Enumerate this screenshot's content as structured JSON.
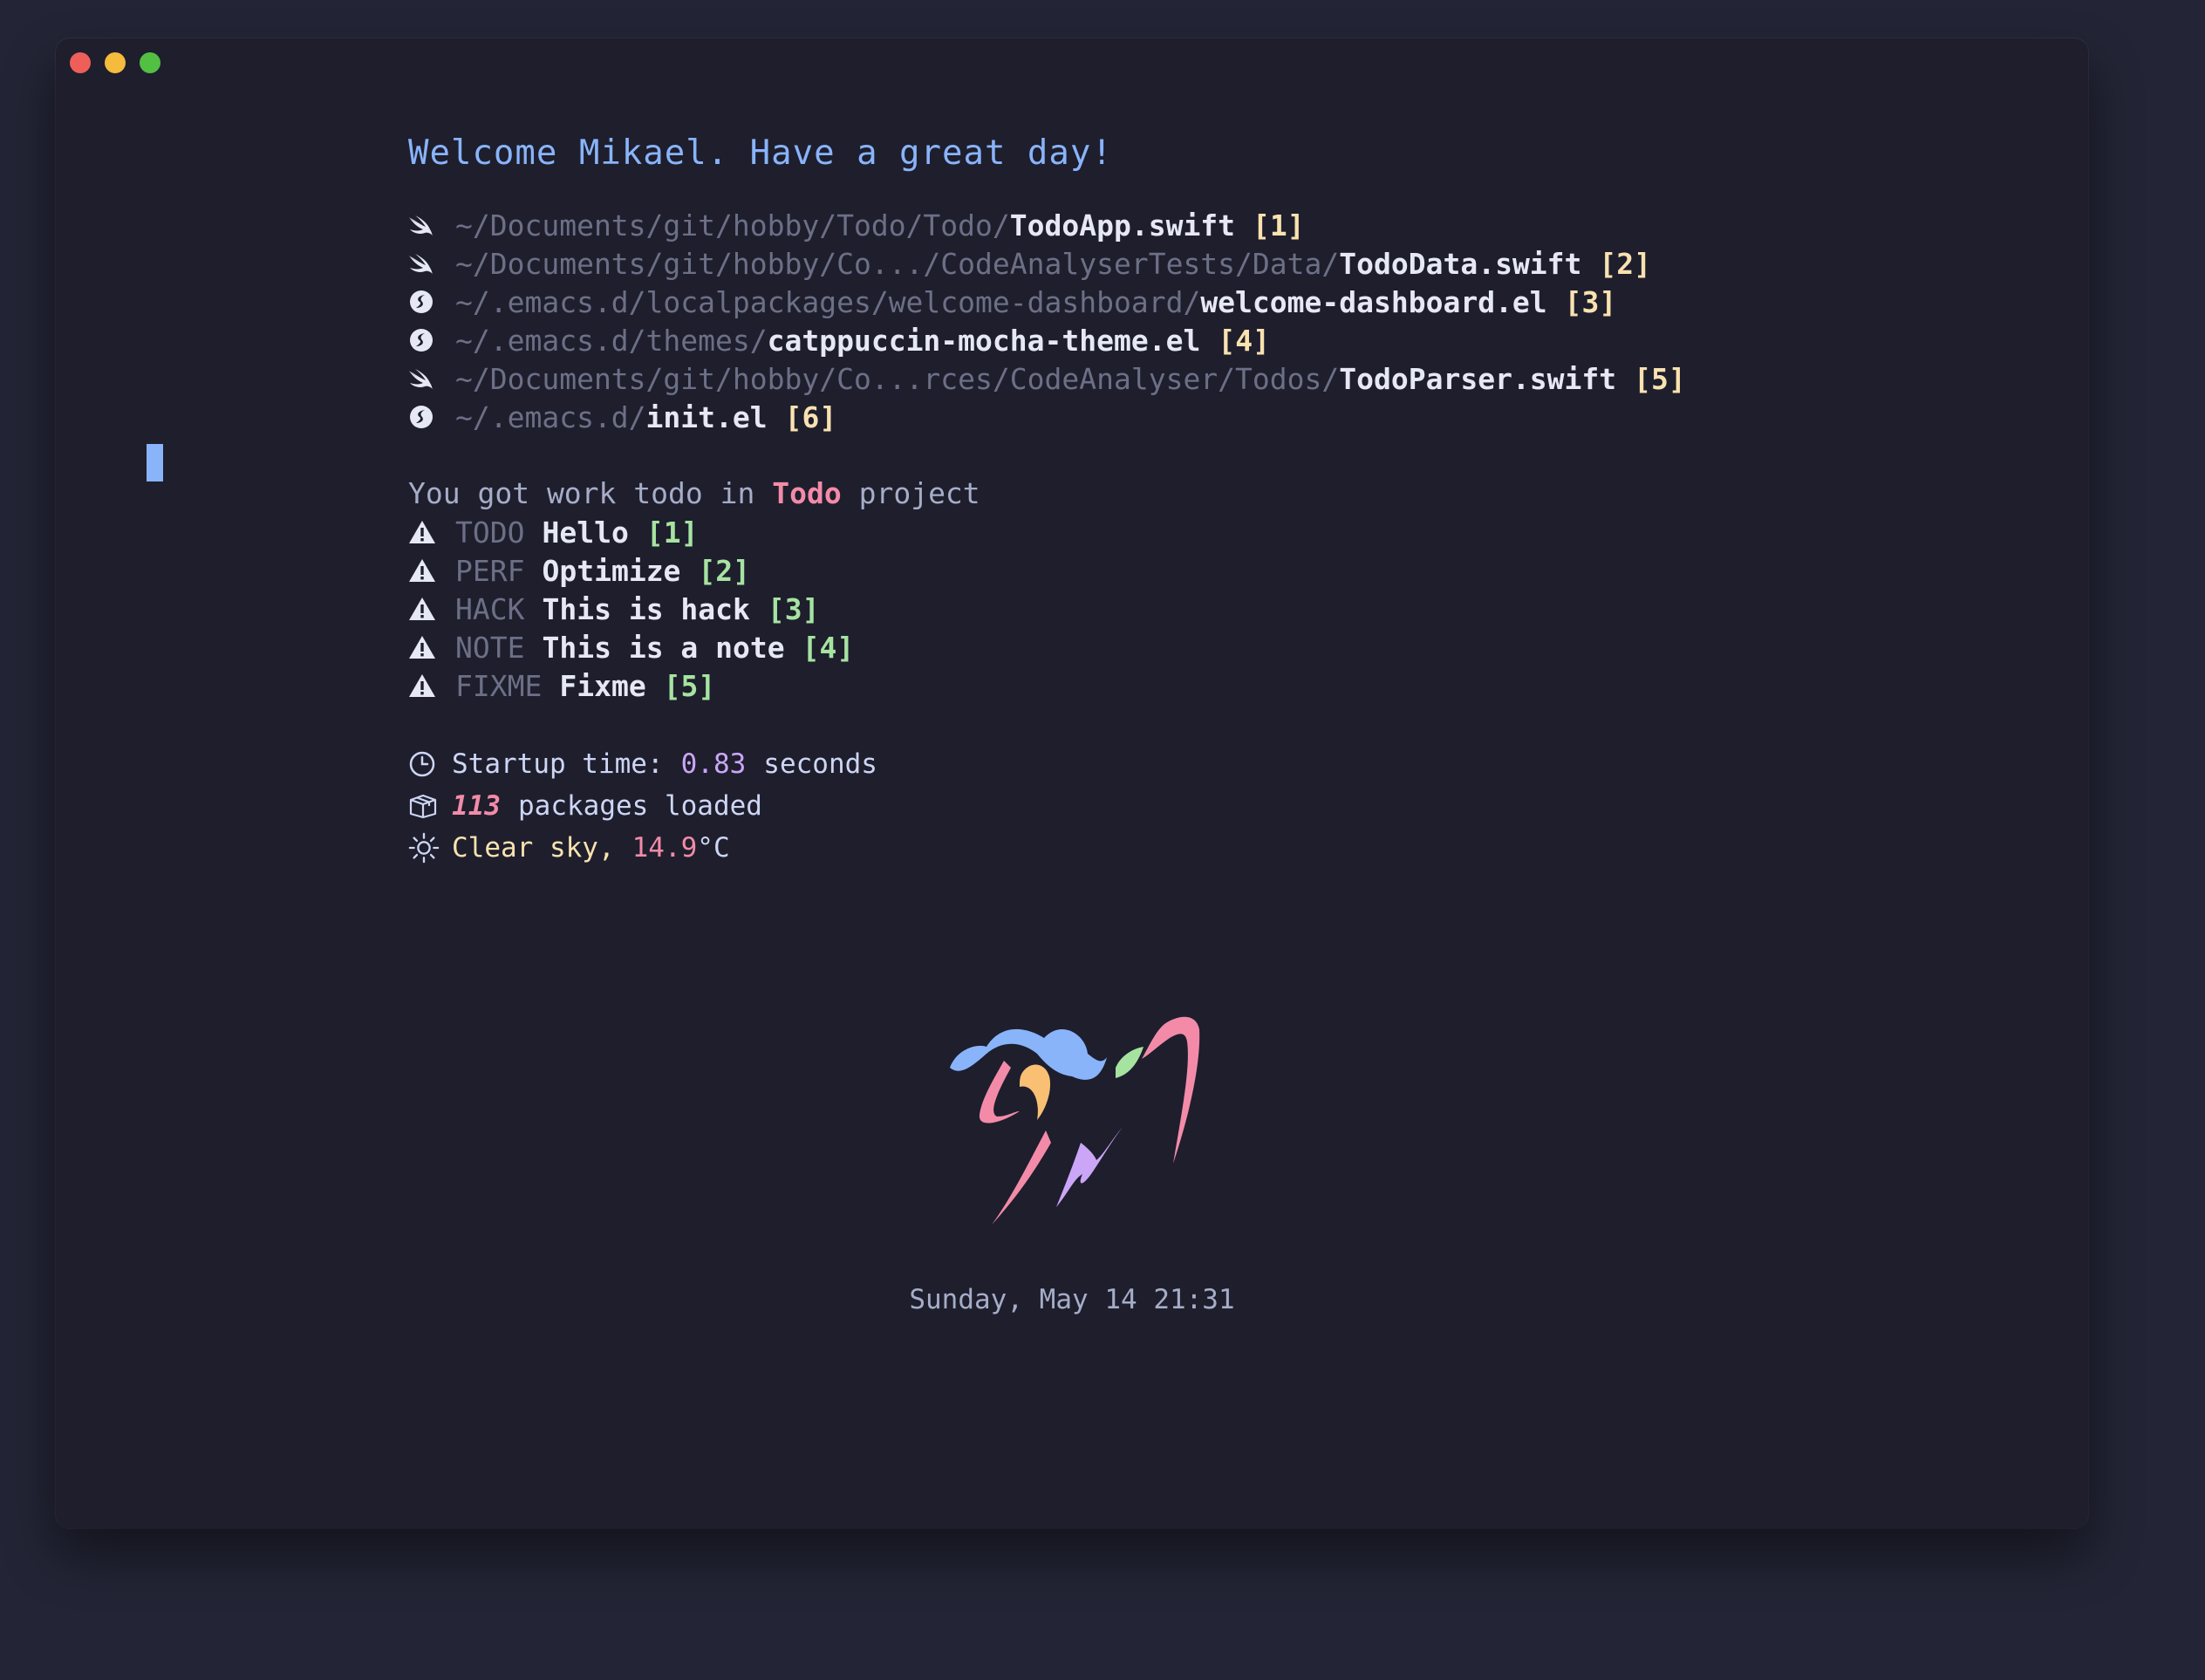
{
  "welcome": "Welcome Mikael. Have a great day!",
  "recent_files": [
    {
      "icon": "swift-icon",
      "path": "~/Documents/git/hobby/Todo/Todo/",
      "file": "TodoApp.swift",
      "key": "[1]"
    },
    {
      "icon": "swift-icon",
      "path": "~/Documents/git/hobby/Co.../CodeAnalyserTests/Data/",
      "file": "TodoData.swift",
      "key": "[2]"
    },
    {
      "icon": "emacs-icon",
      "path": "~/.emacs.d/localpackages/welcome-dashboard/",
      "file": "welcome-dashboard.el",
      "key": "[3]"
    },
    {
      "icon": "emacs-icon",
      "path": "~/.emacs.d/themes/",
      "file": "catppuccin-mocha-theme.el",
      "key": "[4]"
    },
    {
      "icon": "swift-icon",
      "path": "~/Documents/git/hobby/Co...rces/CodeAnalyser/Todos/",
      "file": "TodoParser.swift",
      "key": "[5]"
    },
    {
      "icon": "emacs-icon",
      "path": "~/.emacs.d/",
      "file": "init.el",
      "key": "[6]"
    }
  ],
  "todo_section": {
    "prefix": "You got work todo in",
    "project": "Todo",
    "suffix": "project",
    "items": [
      {
        "tag": "TODO",
        "text": "Hello",
        "key": "[1]"
      },
      {
        "tag": "PERF",
        "text": "Optimize",
        "key": "[2]"
      },
      {
        "tag": "HACK",
        "text": "This is hack",
        "key": "[3]"
      },
      {
        "tag": "NOTE",
        "text": "This is a note",
        "key": "[4]"
      },
      {
        "tag": "FIXME",
        "text": "Fixme",
        "key": "[5]"
      }
    ]
  },
  "info": {
    "startup_label": "Startup time:",
    "startup_value": "0.83",
    "startup_unit": "seconds",
    "packages_count": "113",
    "packages_label": "packages loaded",
    "weather_desc": "Clear sky,",
    "temperature": "14.9",
    "temperature_unit": "°C"
  },
  "datetime": "Sunday, May 14 21:31",
  "colors": {
    "background": "#1e1e2d",
    "blue": "#89b4fa",
    "red": "#f38ba8",
    "green": "#a6e3a1",
    "yellow": "#f9e2af",
    "purple": "#cba6f7",
    "muted": "#6c7086"
  }
}
